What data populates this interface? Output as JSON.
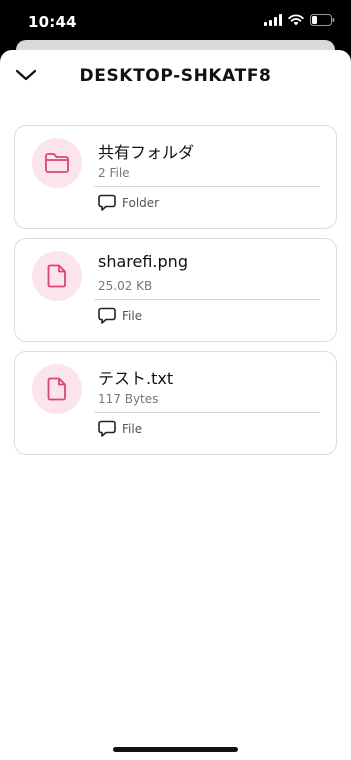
{
  "status": {
    "time": "10:44"
  },
  "header": {
    "title": "DESKTOP-SHKATF8"
  },
  "items": [
    {
      "name": "共有フォルダ",
      "meta": "2 File",
      "type": "Folder",
      "icon": "folder-icon"
    },
    {
      "name": "sharefi.png",
      "meta": "25.02 KB",
      "type": "File",
      "icon": "file-icon"
    },
    {
      "name": "テスト.txt",
      "meta": "117 Bytes",
      "type": "File",
      "icon": "file-icon"
    }
  ],
  "colors": {
    "accent": "#d9457a",
    "accent_bg": "#fce4ee"
  }
}
